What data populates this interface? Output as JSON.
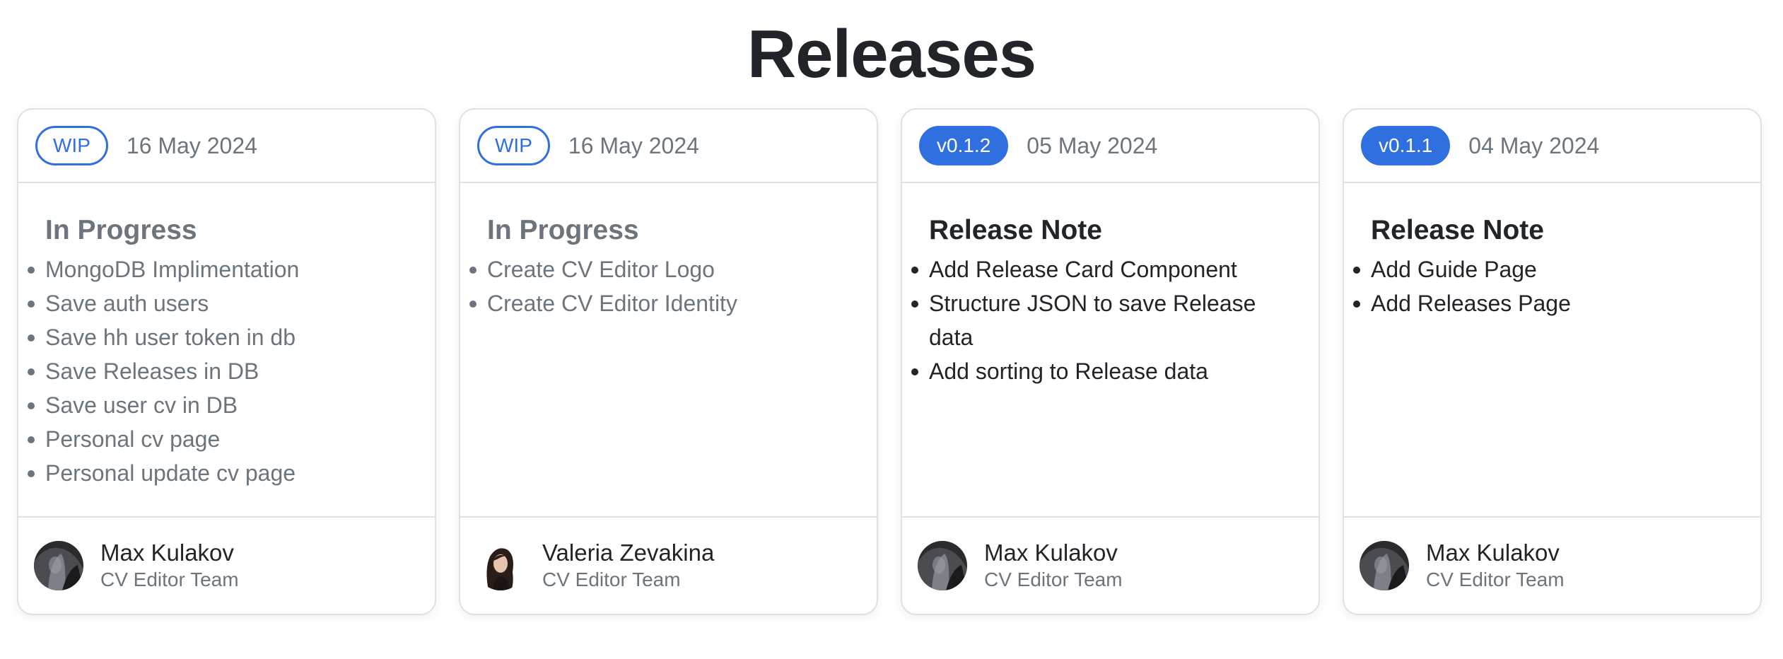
{
  "page": {
    "title": "Releases"
  },
  "colors": {
    "accent": "#2f6fdf",
    "muted": "#6c757d",
    "text": "#212529",
    "border": "#dee2e6"
  },
  "cards": [
    {
      "badge": "WIP",
      "badge_style": "outline",
      "date": "16 May 2024",
      "section_title": "In Progress",
      "tone": "muted",
      "items": [
        "MongoDB Implimentation",
        "Save auth users",
        "Save hh user token in db",
        "Save Releases in DB",
        "Save user cv in DB",
        "Personal cv page",
        "Personal update cv page"
      ],
      "author": {
        "name": "Max Kulakov",
        "team": "CV Editor Team",
        "avatar_icon": "avatar-dark-photo"
      }
    },
    {
      "badge": "WIP",
      "badge_style": "outline",
      "date": "16 May 2024",
      "section_title": "In Progress",
      "tone": "muted",
      "items": [
        "Create CV Editor Logo",
        "Create CV Editor Identity"
      ],
      "author": {
        "name": "Valeria Zevakina",
        "team": "CV Editor Team",
        "avatar_icon": "avatar-woman-photo"
      }
    },
    {
      "badge": "v0.1.2",
      "badge_style": "filled",
      "date": "05 May 2024",
      "section_title": "Release Note",
      "tone": "dark",
      "items": [
        "Add Release Card Component",
        "Structure JSON to save Release data",
        "Add sorting to Release data"
      ],
      "author": {
        "name": "Max Kulakov",
        "team": "CV Editor Team",
        "avatar_icon": "avatar-dark-photo"
      }
    },
    {
      "badge": "v0.1.1",
      "badge_style": "filled",
      "date": "04 May 2024",
      "section_title": "Release Note",
      "tone": "dark",
      "items": [
        "Add Guide Page",
        "Add Releases Page"
      ],
      "author": {
        "name": "Max Kulakov",
        "team": "CV Editor Team",
        "avatar_icon": "avatar-dark-photo"
      }
    }
  ]
}
